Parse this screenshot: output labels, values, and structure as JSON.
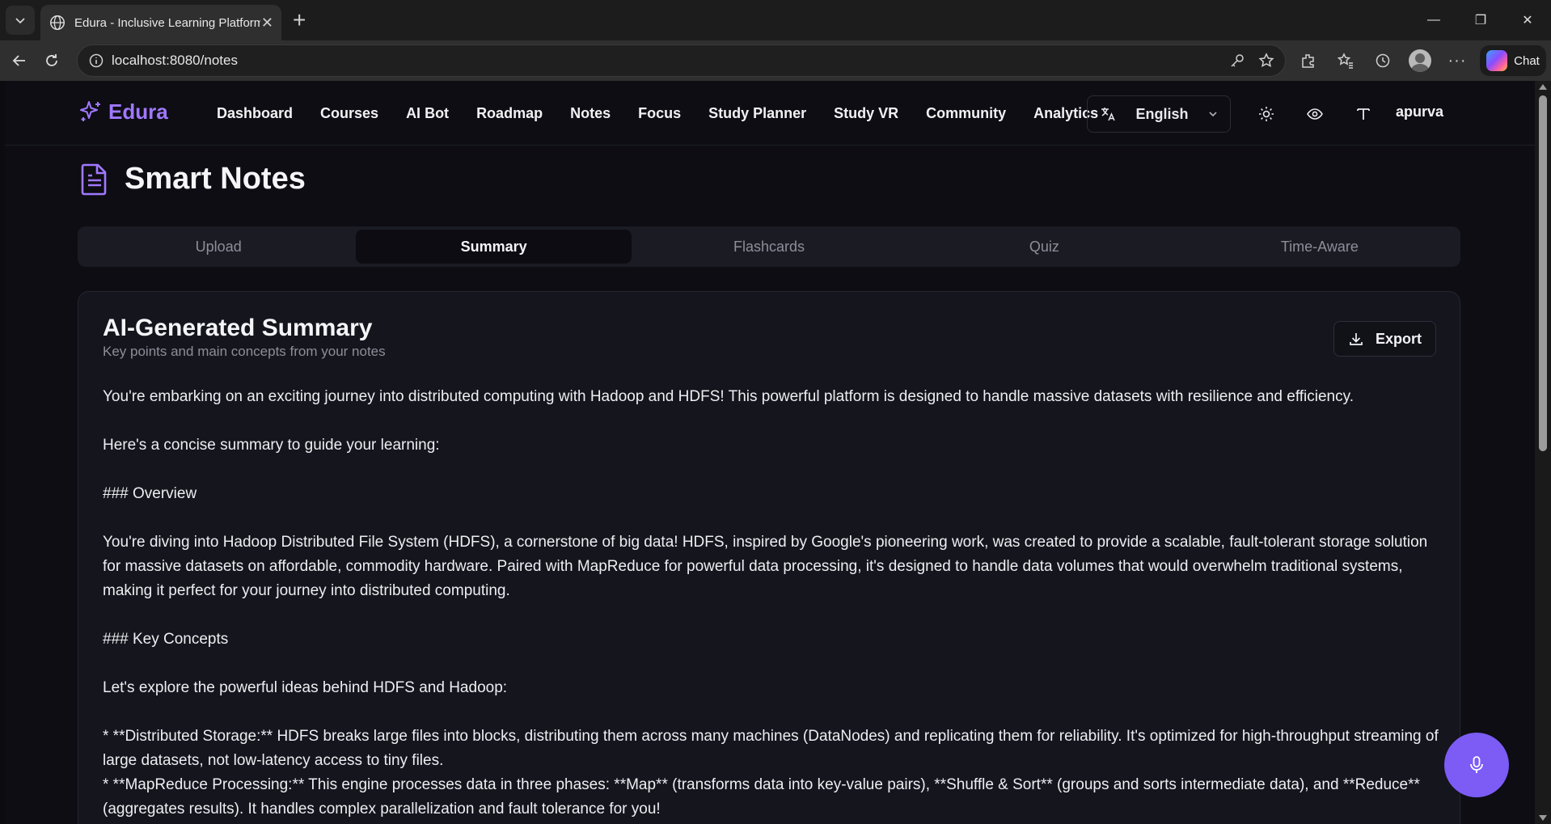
{
  "browser": {
    "tab_title": "Edura - Inclusive Learning Platform",
    "url": "localhost:8080/notes",
    "chat_label": "Chat"
  },
  "app": {
    "brand": "Edura",
    "nav": [
      "Dashboard",
      "Courses",
      "AI Bot",
      "Roadmap",
      "Notes",
      "Focus",
      "Study Planner",
      "Study VR",
      "Community",
      "Analytics"
    ],
    "language": "English",
    "username": "apurva",
    "accent_color": "#a078ff"
  },
  "page": {
    "title": "Smart Notes",
    "tabs": [
      "Upload",
      "Summary",
      "Flashcards",
      "Quiz",
      "Time-Aware"
    ],
    "active_tab": "Summary"
  },
  "card": {
    "title": "AI-Generated Summary",
    "subtitle": "Key points and main concepts from your notes",
    "export_label": "Export",
    "paragraphs": [
      "You're embarking on an exciting journey into distributed computing with Hadoop and HDFS! This powerful platform is designed to handle massive datasets with resilience and efficiency.",
      "Here's a concise summary to guide your learning:",
      "### Overview",
      "You're diving into Hadoop Distributed File System (HDFS), a cornerstone of big data! HDFS, inspired by Google's pioneering work, was created to provide a scalable, fault-tolerant storage solution for massive datasets on affordable, commodity hardware. Paired with MapReduce for powerful data processing, it's designed to handle data volumes that would overwhelm traditional systems, making it perfect for your journey into distributed computing.",
      "### Key Concepts",
      "Let's explore the powerful ideas behind HDFS and Hadoop:",
      "*   **Distributed Storage:** HDFS breaks large files into blocks, distributing them across many machines (DataNodes) and replicating them for reliability. It's optimized for high-throughput streaming of large datasets, not low-latency access to tiny files.",
      "*   **MapReduce Processing:** This engine processes data in three phases: **Map** (transforms data into key-value pairs), **Shuffle & Sort** (groups and sorts intermediate data), and **Reduce** (aggregates results). It handles complex parallelization and fault tolerance for you!"
    ]
  }
}
